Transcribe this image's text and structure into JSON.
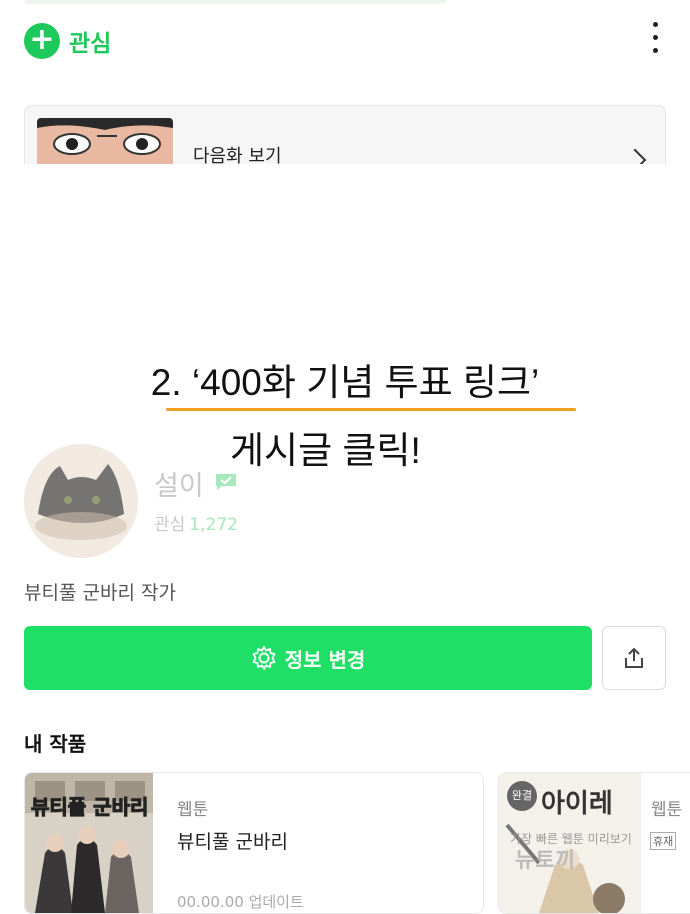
{
  "header": {
    "follow_label": "관심"
  },
  "next_episode": {
    "label": "다음화 보기"
  },
  "instruction": {
    "line1": "2. ‘400화 기념 투표 링크’",
    "line2": "게시글 클릭!"
  },
  "profile": {
    "name": "설이",
    "follower_label": "관심",
    "follower_count": "1,272",
    "bio": "뷰티풀 군바리 작가",
    "edit_label": "정보 변경"
  },
  "works": {
    "section_title": "내 작품",
    "items": [
      {
        "cover_text": "뷰티풀 군바리",
        "genre": "웹툰",
        "title": "뷰티풀 군바리",
        "date": "00.00.00 업데이트"
      },
      {
        "badge": "완결",
        "cover_text": "아이레",
        "genre": "웹툰"
      }
    ]
  },
  "watermark": {
    "line1": "가장 빠른 웹툰 미리보기",
    "line2": "뉴토끼",
    "rest_badge": "휴재"
  },
  "colors": {
    "accent_green": "#1ec95b",
    "button_green": "#1ee066",
    "underline_orange": "#f0a020"
  }
}
